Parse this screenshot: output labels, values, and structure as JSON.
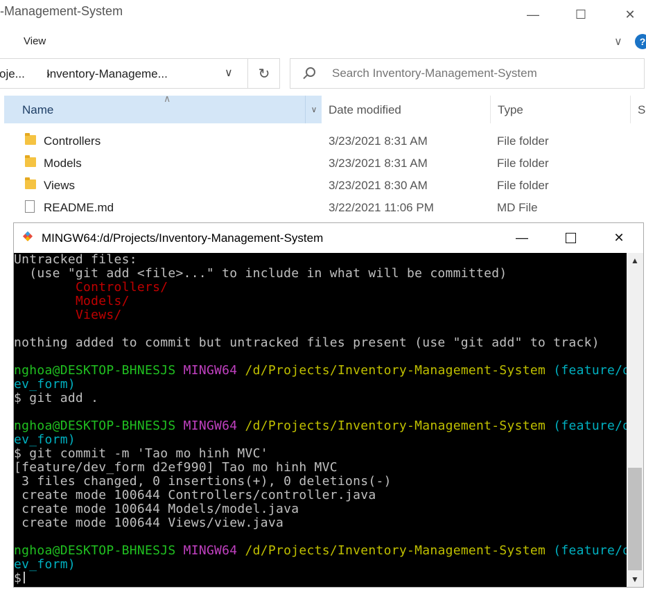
{
  "explorer": {
    "title_fragment": "-Management-System",
    "menu": {
      "view": "View"
    },
    "address": {
      "part1": "oje...",
      "part2": "Inventory-Manageme..."
    },
    "search": {
      "placeholder": "Search Inventory-Management-System"
    },
    "columns": {
      "name": "Name",
      "date": "Date modified",
      "type": "Type",
      "size": "Si"
    },
    "files": [
      {
        "name": "Controllers",
        "date": "3/23/2021 8:31 AM",
        "type": "File folder",
        "icon": "folder-icon"
      },
      {
        "name": "Models",
        "date": "3/23/2021 8:31 AM",
        "type": "File folder",
        "icon": "folder-icon"
      },
      {
        "name": "Views",
        "date": "3/23/2021 8:30 AM",
        "type": "File folder",
        "icon": "folder-icon"
      },
      {
        "name": "README.md",
        "date": "3/22/2021 11:06 PM",
        "type": "MD File",
        "icon": "file-icon"
      }
    ]
  },
  "terminal": {
    "title": "MINGW64:/d/Projects/Inventory-Management-System",
    "colors": {
      "red": "#c00000",
      "green": "#20c020",
      "magenta": "#c040c0",
      "yellow": "#c0c000",
      "cyan": "#00b0c0",
      "text": "#c0c0c0"
    },
    "lines": [
      [
        {
          "t": "Untracked files:"
        }
      ],
      [
        {
          "t": "  (use \"git add <file>...\" to include in what will be committed)"
        }
      ],
      [
        {
          "t": "        "
        },
        {
          "t": "Controllers/",
          "c": "red"
        }
      ],
      [
        {
          "t": "        "
        },
        {
          "t": "Models/",
          "c": "red"
        }
      ],
      [
        {
          "t": "        "
        },
        {
          "t": "Views/",
          "c": "red"
        }
      ],
      [
        {
          "t": ""
        }
      ],
      [
        {
          "t": "nothing added to commit but untracked files present (use \"git add\" to track)"
        }
      ],
      [
        {
          "t": ""
        }
      ],
      [
        {
          "t": "nghoa@DESKTOP-BHNESJS",
          "c": "green"
        },
        {
          "t": " "
        },
        {
          "t": "MINGW64",
          "c": "magenta"
        },
        {
          "t": " "
        },
        {
          "t": "/d/Projects/Inventory-Management-System",
          "c": "yellow"
        },
        {
          "t": " "
        },
        {
          "t": "(feature/d",
          "c": "cyan"
        }
      ],
      [
        {
          "t": "ev_form)",
          "c": "cyan"
        }
      ],
      [
        {
          "t": "$ git add ."
        }
      ],
      [
        {
          "t": ""
        }
      ],
      [
        {
          "t": "nghoa@DESKTOP-BHNESJS",
          "c": "green"
        },
        {
          "t": " "
        },
        {
          "t": "MINGW64",
          "c": "magenta"
        },
        {
          "t": " "
        },
        {
          "t": "/d/Projects/Inventory-Management-System",
          "c": "yellow"
        },
        {
          "t": " "
        },
        {
          "t": "(feature/d",
          "c": "cyan"
        }
      ],
      [
        {
          "t": "ev_form)",
          "c": "cyan"
        }
      ],
      [
        {
          "t": "$ git commit -m 'Tao mo hinh MVC'"
        }
      ],
      [
        {
          "t": "[feature/dev_form d2ef990] Tao mo hinh MVC"
        }
      ],
      [
        {
          "t": " 3 files changed, 0 insertions(+), 0 deletions(-)"
        }
      ],
      [
        {
          "t": " create mode 100644 Controllers/controller.java"
        }
      ],
      [
        {
          "t": " create mode 100644 Models/model.java"
        }
      ],
      [
        {
          "t": " create mode 100644 Views/view.java"
        }
      ],
      [
        {
          "t": ""
        }
      ],
      [
        {
          "t": "nghoa@DESKTOP-BHNESJS",
          "c": "green"
        },
        {
          "t": " "
        },
        {
          "t": "MINGW64",
          "c": "magenta"
        },
        {
          "t": " "
        },
        {
          "t": "/d/Projects/Inventory-Management-System",
          "c": "yellow"
        },
        {
          "t": " "
        },
        {
          "t": "(feature/d",
          "c": "cyan"
        }
      ],
      [
        {
          "t": "ev_form)",
          "c": "cyan"
        }
      ],
      [
        {
          "t": "$",
          "cursor": true
        }
      ]
    ]
  }
}
